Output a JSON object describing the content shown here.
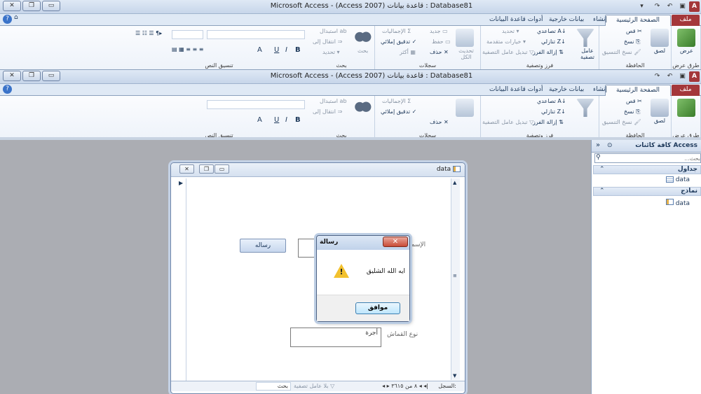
{
  "app": {
    "title": "Microsoft Access - (Access 2007) قاعدة بيانات : Database81"
  },
  "tabs": [
    {
      "label": "ملف"
    },
    {
      "label": "الصفحة الرئيسية"
    },
    {
      "label": "إنشاء"
    },
    {
      "label": "بيانات خارجية"
    },
    {
      "label": "أدوات قاعدة البيانات"
    }
  ],
  "ribbon": {
    "views_label": "عرض",
    "views_group": "طرق عرض",
    "paste_label": "لصق",
    "cut_label": "قص",
    "copy_label": "نسخ",
    "format_painter_label": "نسخ التنسيق",
    "clipboard_group": "الحافظة",
    "filter_label": "عامل تصفية",
    "ascending_label": "تصاعدي",
    "descending_label": "تنازلي",
    "remove_sort_label": "إزالة الفرز",
    "selection_label": "تحديد",
    "advanced_label": "خيارات متقدمة",
    "toggle_filter_label": "تبديل عامل التصفية",
    "sort_filter_group": "فرز وتصفية",
    "refresh_label": "تحديث الكل",
    "new_label": "جديد",
    "save_label": "حفظ",
    "delete_label": "حذف",
    "totals_label": "الإجماليات",
    "spelling_label": "تدقيق إملائي",
    "more_label": "أكثر",
    "records_group": "سجلات",
    "find_label": "بحث",
    "replace_label": "استبدال",
    "goto_label": "انتقال إلى",
    "select_label": "تحديد",
    "find_group": "بحث",
    "text_format_group": "تنسيق النص",
    "bold": "B",
    "italic": "I",
    "underline": "U",
    "font_color": "A"
  },
  "nav": {
    "header": "كافة كائنات Access",
    "search_placeholder": "بحث...",
    "tables_section": "جداول",
    "table_item": "data",
    "forms_section": "نماذج",
    "form_item": "data"
  },
  "form": {
    "title": "data",
    "button_label": "رساله",
    "name_label": "الإسم",
    "fabric_label": "نوع القماش",
    "fabric_value": "أجرة",
    "record_label": "السجل:",
    "record_nav": "٨ من ٣٦١٥",
    "no_filter": "بلا عامل تصفية",
    "search": "بحث"
  },
  "message": {
    "title": "رسالة",
    "text": "ايه الله الشليق",
    "ok_label": "موافق"
  }
}
